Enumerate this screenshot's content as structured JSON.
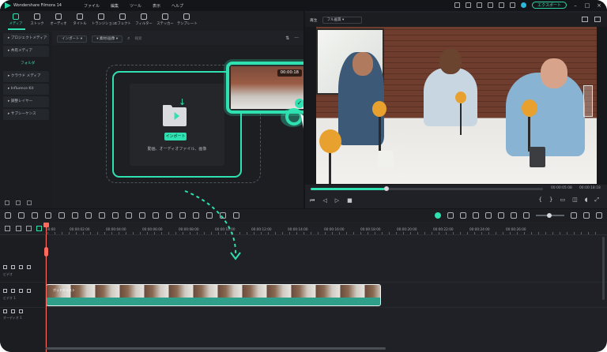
{
  "titlebar": {
    "app_title": "Wondershare Filmora 14",
    "menu": [
      "ファイル",
      "編集",
      "ツール",
      "表示",
      "ヘルプ"
    ],
    "badge_label": "エクスポート",
    "min": "–",
    "max": "□",
    "close": "×"
  },
  "tools": [
    {
      "label": "メディア",
      "icon": "media-icon"
    },
    {
      "label": "ストック",
      "icon": "stock-icon"
    },
    {
      "label": "オーディオ",
      "icon": "music-icon"
    },
    {
      "label": "タイトル",
      "icon": "title-icon"
    },
    {
      "label": "トランジション",
      "icon": "transition-icon"
    },
    {
      "label": "エフェクト",
      "icon": "effect-icon"
    },
    {
      "label": "フィルター",
      "icon": "filter-icon"
    },
    {
      "label": "ステッカー",
      "icon": "sticker-icon"
    },
    {
      "label": "テンプレート",
      "icon": "template-icon"
    }
  ],
  "sidebar": {
    "items": [
      {
        "label": "▸ プロジェクトメディア"
      },
      {
        "label": "▸ 共有メディア"
      },
      {
        "label": "フォルダ"
      },
      {
        "label": "▸ クラウド メディア"
      },
      {
        "label": "▸ Influence Kit"
      },
      {
        "label": "▸ 調整レイヤー"
      },
      {
        "label": "▸ サブシーケンス"
      }
    ]
  },
  "media_toolbar": {
    "import_dropdown": "インポート ▾",
    "sort_dropdown": "▾ 素材/画像 ▾",
    "search_placeholder": "検索",
    "filter": "⇅",
    "more": "···"
  },
  "import_area": {
    "button_label": "インポート",
    "hint": "動画、オーディオファイル、画像"
  },
  "thumbnail": {
    "duration": "00:00:18"
  },
  "preview": {
    "label": "再生",
    "quality": "フル画質 ▾",
    "time_current": "00:00:05:08",
    "time_total": "00:00:18:18"
  },
  "playback": {
    "prev": "⏮",
    "play_back": "◁",
    "play": "▷",
    "stop": "▷",
    "square": "■",
    "mark_in": "{",
    "mark_out": "}"
  },
  "timeline": {
    "ruler": [
      "00:00",
      "00:00:02:00",
      "00:00:04:00",
      "00:00:06:00",
      "00:00:08:00",
      "00:00:10:00",
      "00:00:12:00",
      "00:00:14:00",
      "00:00:16:00",
      "00:00:18:00",
      "00:00:20:00",
      "00:00:22:00",
      "00:00:24:00",
      "00:00:26:00"
    ],
    "tracks": [
      {
        "label": "ビデオ"
      },
      {
        "label": "ビデオ 1"
      },
      {
        "label": "オーディオ 1"
      }
    ],
    "clip_label": "ポッドキャスト"
  },
  "colors": {
    "accent": "#2fe0b0",
    "playhead": "#ff6a5c",
    "background": "#1f2126"
  }
}
